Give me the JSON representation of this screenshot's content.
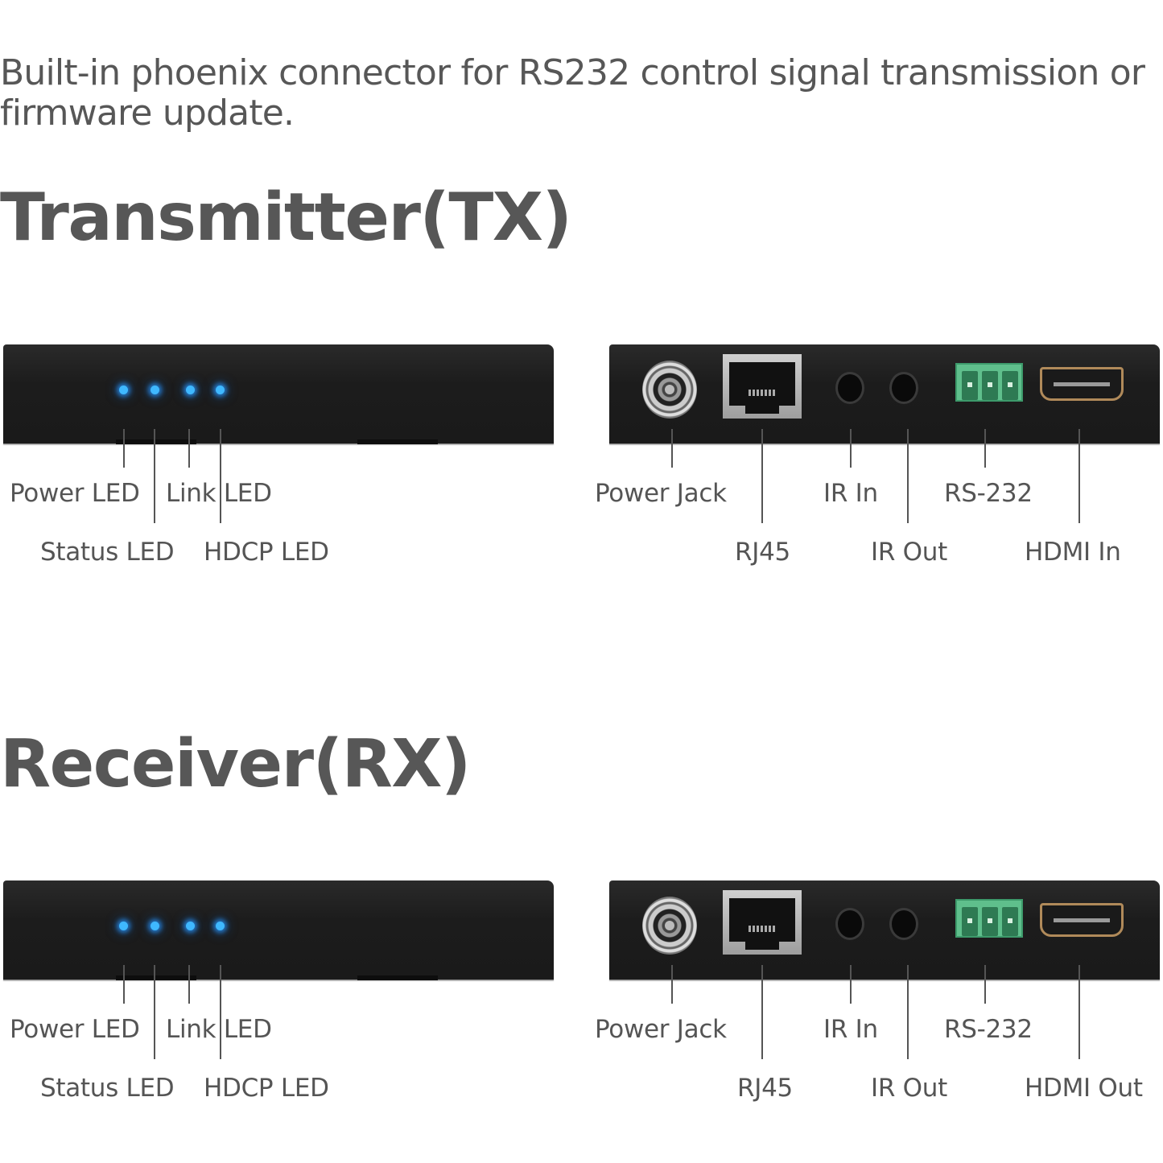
{
  "intro_text": "Built-in phoenix connector for RS232 control signal transmission or firmware update.",
  "colors": {
    "text": "#575757",
    "led": "#3fb8ff",
    "device_body": "#1c1c1c",
    "phoenix_connector": "#5fbf8c",
    "hdmi_trim": "#b08a5a"
  },
  "transmitter": {
    "heading": "Transmitter(TX)",
    "front_labels": {
      "power_led": "Power LED",
      "status_led": "Status LED",
      "link_led": "Link LED",
      "hdcp_led": "HDCP LED"
    },
    "rear_labels": {
      "power_jack": "Power Jack",
      "rj45": "RJ45",
      "ir_in": "IR In",
      "ir_out": "IR Out",
      "rs232": "RS-232",
      "hdmi": "HDMI In"
    }
  },
  "receiver": {
    "heading": "Receiver(RX)",
    "front_labels": {
      "power_led": "Power LED",
      "status_led": "Status LED",
      "link_led": "Link LED",
      "hdcp_led": "HDCP LED"
    },
    "rear_labels": {
      "power_jack": "Power Jack",
      "rj45": "RJ45",
      "ir_in": "IR In",
      "ir_out": "IR Out",
      "rs232": "RS-232",
      "hdmi": "HDMI Out"
    }
  }
}
